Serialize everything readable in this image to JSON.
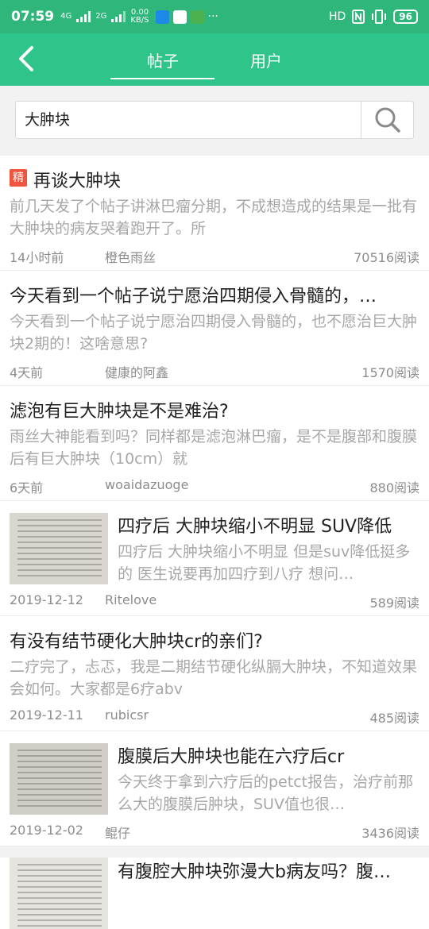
{
  "status_bar": {
    "time": "07:59",
    "net_type": "4G",
    "net_speed_value": "0.00",
    "net_speed_unit": "KB/S",
    "extra_signal": "2G",
    "more": "···",
    "hd": "HD",
    "battery": "96"
  },
  "nav": {
    "tabs": [
      {
        "label": "帖子",
        "active": true
      },
      {
        "label": "用户",
        "active": false
      }
    ]
  },
  "search": {
    "query": "大肿块"
  },
  "posts": [
    {
      "badge": "精",
      "title": "再谈大肿块",
      "excerpt": "前几天发了个帖子讲淋巴瘤分期，不成想造成的结果是一批有大肿块的病友哭着跑开了。所",
      "date": "14小时前",
      "author": "橙色雨丝",
      "reads": "70516阅读"
    },
    {
      "title": "今天看到一个帖子说宁愿治四期侵入骨髓的，…",
      "excerpt": "今天看到一个帖子说宁愿治四期侵入骨髓的，也不愿治巨大肿块2期的！这啥意思?",
      "date": "4天前",
      "author": "健康的阿鑫",
      "reads": "1570阅读"
    },
    {
      "title": "滤泡有巨大肿块是不是难治?",
      "excerpt": "雨丝大神能看到吗？同样都是滤泡淋巴瘤，是不是腹部和腹膜后有巨大肿块（10cm）就",
      "date": "6天前",
      "author": "woaidazuoge",
      "reads": "880阅读"
    },
    {
      "title": "四疗后 大肿块缩小不明显 SUV降低",
      "excerpt": "四疗后 大肿块缩小不明显 但是suv降低挺多的 医生说要再加四疗到八疗 想问…",
      "date": "2019-12-12",
      "author": "Ritelove",
      "reads": "589阅读"
    },
    {
      "title": "有没有结节硬化大肿块cr的亲们?",
      "excerpt": "二疗完了，忐忑，我是二期结节硬化纵膈大肿块，不知道效果会如何。大家都是6疗abv",
      "date": "2019-12-11",
      "author": "rubicsr",
      "reads": "485阅读"
    },
    {
      "title": "腹膜后大肿块也能在六疗后cr",
      "excerpt": "今天终于拿到六疗后的petct报告，治疗前那么大的腹膜后肿块，SUV值也很…",
      "date": "2019-12-02",
      "author": "鲲仔",
      "reads": "3436阅读"
    },
    {
      "title": "有腹腔大肿块弥漫大b病友吗？腹…"
    }
  ],
  "colors": {
    "status_bar": "#2fb67a",
    "nav_bar": "#2fc48a",
    "badge": "#f0553f",
    "excerpt": "#a7a7a7",
    "meta": "#8c8c8c"
  }
}
